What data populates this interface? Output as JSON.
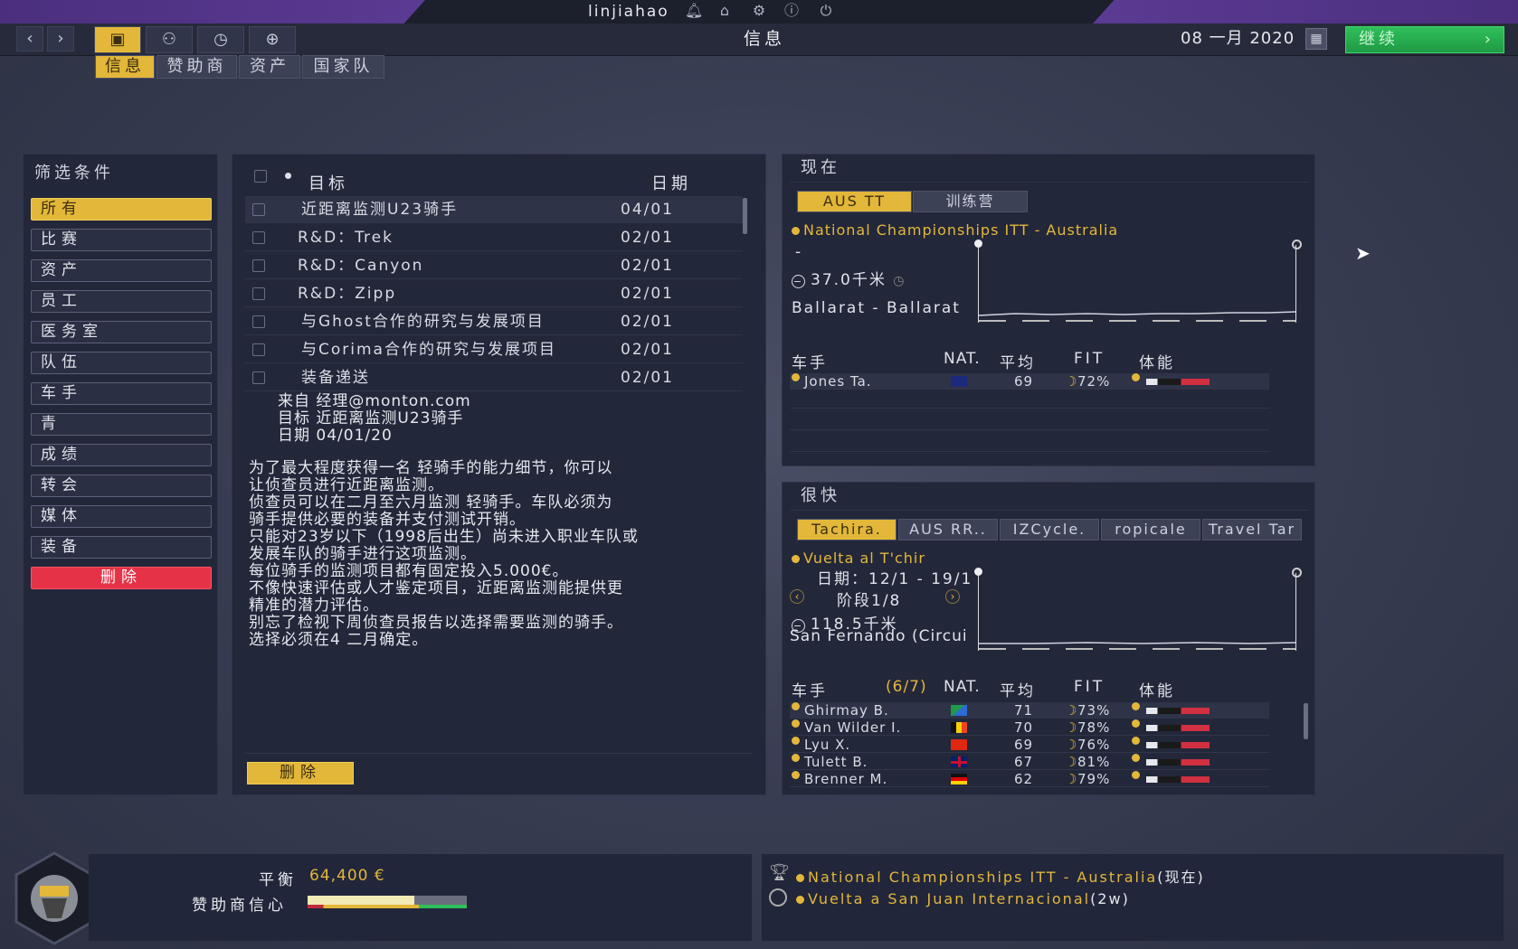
{
  "topbar": {
    "username": "linjiahao",
    "page_title": "信息",
    "date": "08 一月 2020",
    "continue_label": "继续",
    "icons": [
      "bell-icon",
      "home-icon",
      "gear-icon",
      "info-icon",
      "power-icon"
    ]
  },
  "subtabs": [
    {
      "label": "信息",
      "active": true
    },
    {
      "label": "赞助商"
    },
    {
      "label": "资产"
    },
    {
      "label": "国家队"
    }
  ],
  "filters": {
    "title": "筛选条件",
    "items": [
      "所有",
      "比赛",
      "资产",
      "员工",
      "医务室",
      "队伍",
      "车手",
      "青",
      "成绩",
      "转会",
      "媒体",
      "装备"
    ],
    "delete_label": "删除"
  },
  "messages": {
    "header_subject": "目标",
    "header_date": "日期",
    "rows": [
      {
        "subject": "近距离监测U23骑手",
        "date": "04/01"
      },
      {
        "subject": "R&D：Trek",
        "date": "02/01"
      },
      {
        "subject": "R&D：Canyon",
        "date": "02/01"
      },
      {
        "subject": "R&D：Zipp",
        "date": "02/01"
      },
      {
        "subject": "与Ghost合作的研究与发展项目",
        "date": "02/01"
      },
      {
        "subject": "与Corima合作的研究与发展项目",
        "date": "02/01"
      },
      {
        "subject": "装备递送",
        "date": "02/01"
      }
    ],
    "detail": {
      "from": "来自  经理@monton.com",
      "target": "目标  近距离监测U23骑手",
      "date": "日期  04/01/20",
      "body": [
        "为了最大程度获得一名 轻骑手的能力细节，你可以",
        "让侦查员进行近距离监测。",
        "侦查员可以在二月至六月监测 轻骑手。车队必须为",
        "骑手提供必要的装备并支付测试开销。",
        "只能对23岁以下（1998后出生）尚未进入职业车队或",
        "发展车队的骑手进行这项监测。",
        "每位骑手的监测项目都有固定投入5.000€。",
        "不像快速评估或人才鉴定项目，近距离监测能提供更",
        "精准的潜力评估。",
        "别忘了检视下周侦查员报告以选择需要监测的骑手。",
        "选择必须在4 二月确定。"
      ]
    },
    "delete_label": "删除"
  },
  "now_panel": {
    "title": "现在",
    "tabs": [
      "AUS TT",
      "训练营"
    ],
    "race_name": "National Championships ITT - Australia",
    "dash": "-",
    "distance": "37.0千米",
    "route": "Ballarat - Ballarat",
    "headers": {
      "rider": "车手",
      "nat": "NAT.",
      "avg": "平均",
      "fit": "FIT",
      "energy": "体能"
    },
    "riders": [
      {
        "name": "Jones Ta.",
        "avg": "69",
        "fit": "72%"
      }
    ]
  },
  "soon_panel": {
    "title": "很快",
    "tabs": [
      "Tachira.",
      "AUS RR..",
      "IZCycle.",
      "ropicale",
      "Travel Tar"
    ],
    "race_name": "Vuelta al T'chir",
    "dates": "日期：12/1 - 19/1",
    "stage": "阶段1/8",
    "distance": "118.5千米",
    "route": "San Fernando (Circui",
    "headers": {
      "rider": "车手",
      "count": "(6/7)",
      "nat": "NAT.",
      "avg": "平均",
      "fit": "FIT",
      "energy": "体能"
    },
    "riders": [
      {
        "name": "Ghirmay B.",
        "avg": "71",
        "fit": "73%"
      },
      {
        "name": "Van Wilder I.",
        "avg": "70",
        "fit": "78%"
      },
      {
        "name": "Lyu X.",
        "avg": "69",
        "fit": "76%"
      },
      {
        "name": "Tulett B.",
        "avg": "67",
        "fit": "81%"
      },
      {
        "name": "Brenner M.",
        "avg": "62",
        "fit": "79%"
      }
    ]
  },
  "bottom": {
    "balance_label": "平衡",
    "balance_value": "64,400 €",
    "confidence_label": "赞助商信心",
    "confidence_fill": 0.67,
    "events": [
      {
        "name": "National Championships ITT - Australia",
        "suffix": "(现在)"
      },
      {
        "name": "Vuelta a San Juan Internacional",
        "suffix": "(2w)"
      }
    ]
  },
  "colors": {
    "accent": "#e2b73a",
    "continue": "#22a84b",
    "delete": "#e63246"
  }
}
